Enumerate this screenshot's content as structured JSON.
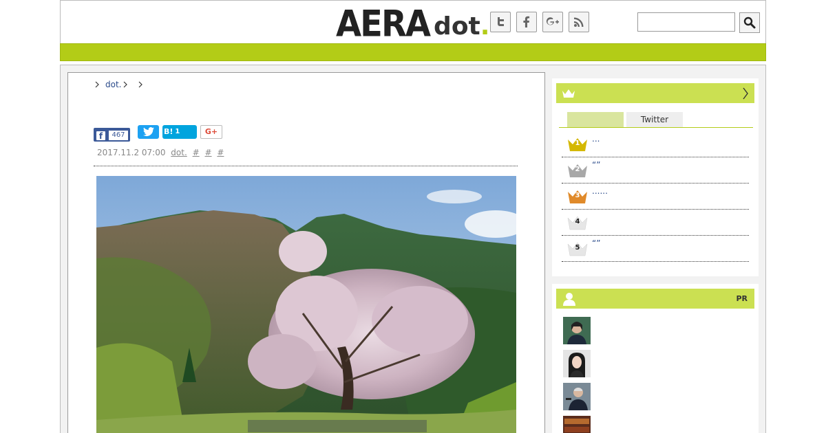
{
  "header": {
    "logo_main": "AERA",
    "logo_sub": "dot",
    "logo_period": ".",
    "social_icons": [
      "twitter-icon",
      "facebook-icon",
      "google-plus-icon",
      "rss-icon"
    ],
    "search": {
      "placeholder": "",
      "value": ""
    }
  },
  "article": {
    "breadcrumb": [
      "dot."
    ],
    "share": {
      "facebook_count": "467",
      "hatena_label": "B!",
      "hatena_count": "1",
      "gplus_label": "G+"
    },
    "date": "2017.11.2 07:00",
    "source": "dot.",
    "tags": [
      "#",
      "#",
      "#"
    ]
  },
  "sidebar": {
    "ranking": {
      "tabs": [
        {
          "label": "",
          "active": true
        },
        {
          "label": "Twitter",
          "active": false
        }
      ],
      "items": [
        {
          "rank": "1",
          "text": "...",
          "color": "#d4b800"
        },
        {
          "rank": "2",
          "text": "“”",
          "color": "#a8a8a8"
        },
        {
          "rank": "3",
          "text": "......",
          "color": "#e08a2a"
        },
        {
          "rank": "4",
          "text": "",
          "color": "#e6e6e6"
        },
        {
          "rank": "5",
          "text": "“”",
          "color": "#e6e6e6"
        }
      ]
    },
    "pr": {
      "label": "PR"
    }
  },
  "colors": {
    "brand_green": "#b3cc17",
    "panel_green": "#cbe052",
    "link_blue": "#2a4a8a"
  }
}
